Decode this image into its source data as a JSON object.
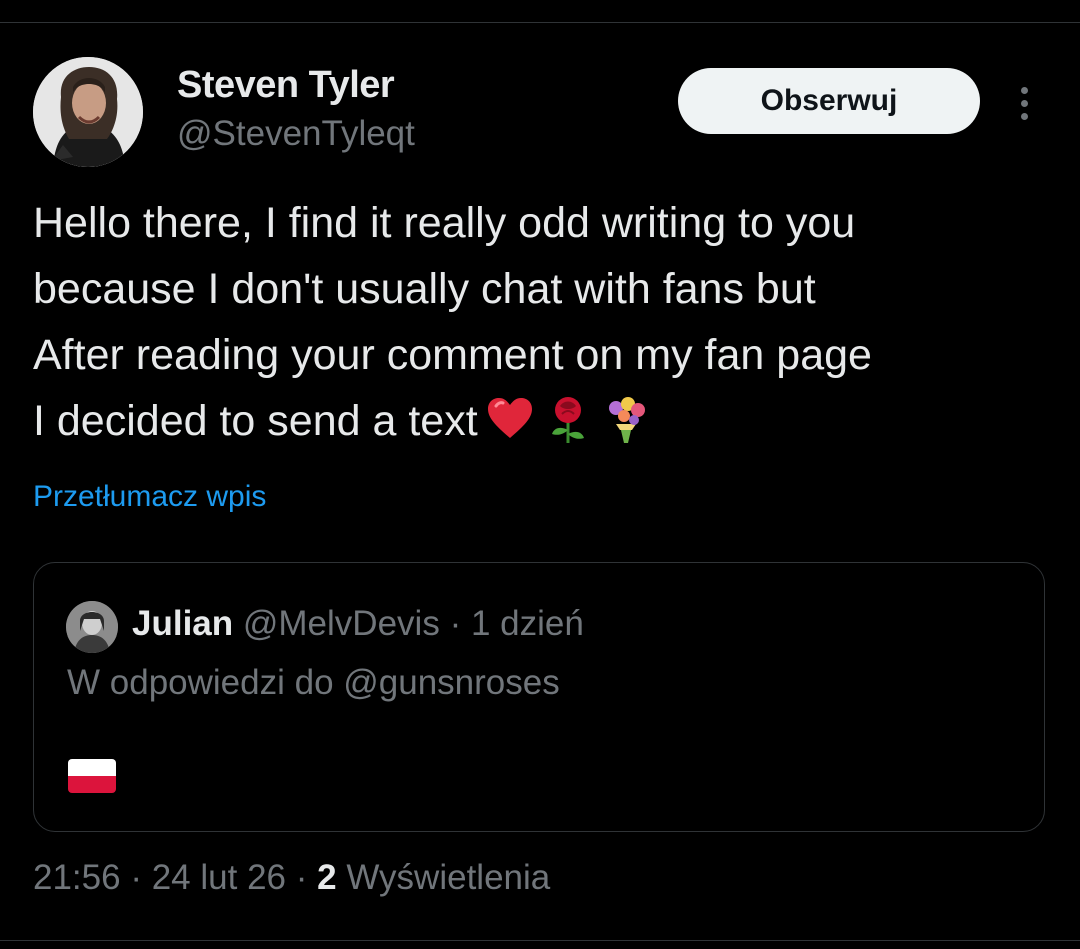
{
  "author": {
    "name": "Steven Tyler",
    "handle": "@StevenTyleqt"
  },
  "follow_label": "Obserwuj",
  "tweet": {
    "lines": [
      "Hello there, I find it really odd writing to you",
      "because I don't usually chat with fans but",
      "After reading your comment on my fan page",
      "I decided to send a text"
    ],
    "emojis": [
      "red-heart",
      "rose",
      "bouquet"
    ]
  },
  "translate_label": "Przetłumacz wpis",
  "quote": {
    "name": "Julian",
    "handle": "@MelvDevis",
    "separator": "·",
    "time": "1 dzień",
    "reply_to": "W odpowiedzi do @gunsnroses",
    "flag": "poland-flag"
  },
  "meta": {
    "time": "21:56",
    "separator": "·",
    "date": "24 lut 26",
    "views_count": "2",
    "views_label": "Wyświetlenia"
  },
  "colors": {
    "background": "#000000",
    "primary_text": "#e7e9ea",
    "secondary_text": "#71767b",
    "link": "#1d9bf0",
    "border": "#2f3336",
    "button_bg": "#eff3f4"
  }
}
